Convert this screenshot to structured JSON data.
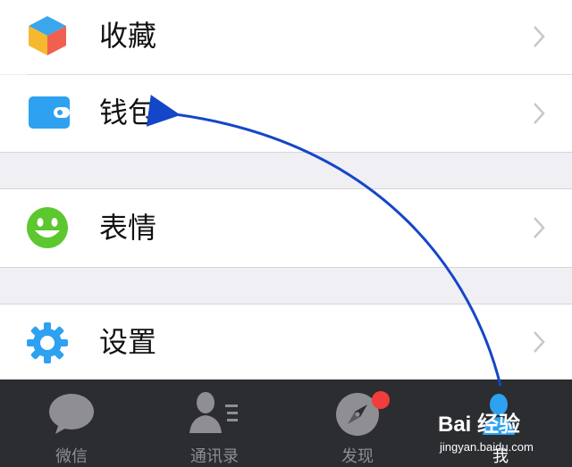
{
  "menu": {
    "items": [
      {
        "label": "收藏",
        "icon": "favorites-cube-icon"
      },
      {
        "label": "钱包",
        "icon": "wallet-icon"
      },
      {
        "label": "表情",
        "icon": "smiley-icon"
      },
      {
        "label": "设置",
        "icon": "settings-gear-icon"
      }
    ]
  },
  "tabbar": {
    "tabs": [
      {
        "label": "微信",
        "icon": "chat-bubble-icon"
      },
      {
        "label": "通讯录",
        "icon": "contacts-icon"
      },
      {
        "label": "发现",
        "icon": "compass-icon",
        "badge": true
      },
      {
        "label": "我",
        "icon": "me-person-icon",
        "active": true
      }
    ]
  },
  "watermark": {
    "brand": "Bai 经验",
    "url": "jingyan.baidu.com"
  },
  "colors": {
    "accent_blue": "#2ea1f1",
    "tab_inactive": "#8e8e93",
    "badge_red": "#f33c3c",
    "arrow_blue": "#1446c8"
  }
}
